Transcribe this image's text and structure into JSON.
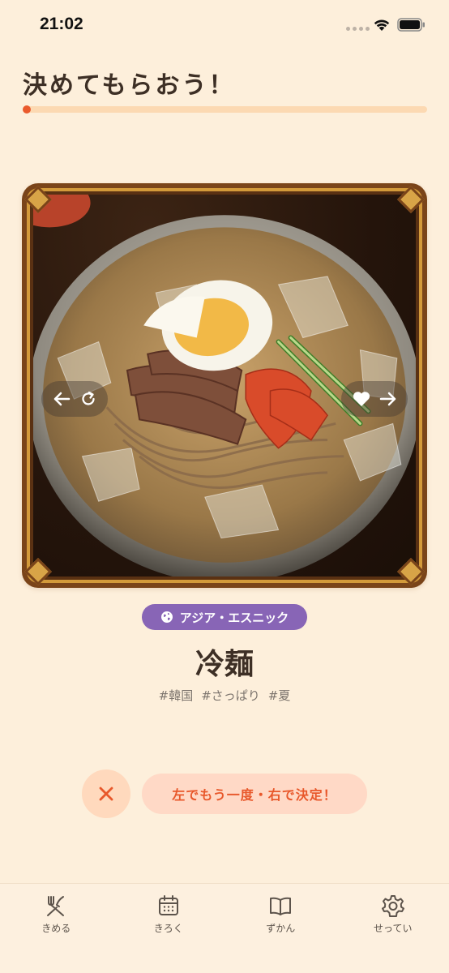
{
  "status": {
    "time": "21:02"
  },
  "page": {
    "title": "決めてもらおう！"
  },
  "progress": {
    "fraction": 0.02
  },
  "dish": {
    "category": "アジア・エスニック",
    "name": "冷麺",
    "tags": [
      "#韓国",
      "#さっぱり",
      "#夏"
    ]
  },
  "actions": {
    "hint": "左でもう一度・右で決定！"
  },
  "tabs": [
    {
      "label": "きめる",
      "icon": "fork-knife-icon"
    },
    {
      "label": "きろく",
      "icon": "calendar-icon"
    },
    {
      "label": "ずかん",
      "icon": "book-icon"
    },
    {
      "label": "せってい",
      "icon": "gear-icon"
    }
  ],
  "colors": {
    "background": "#fdefdb",
    "accent": "#ea5a2c",
    "badge": "#8865b6",
    "frame": "#7a4419"
  }
}
